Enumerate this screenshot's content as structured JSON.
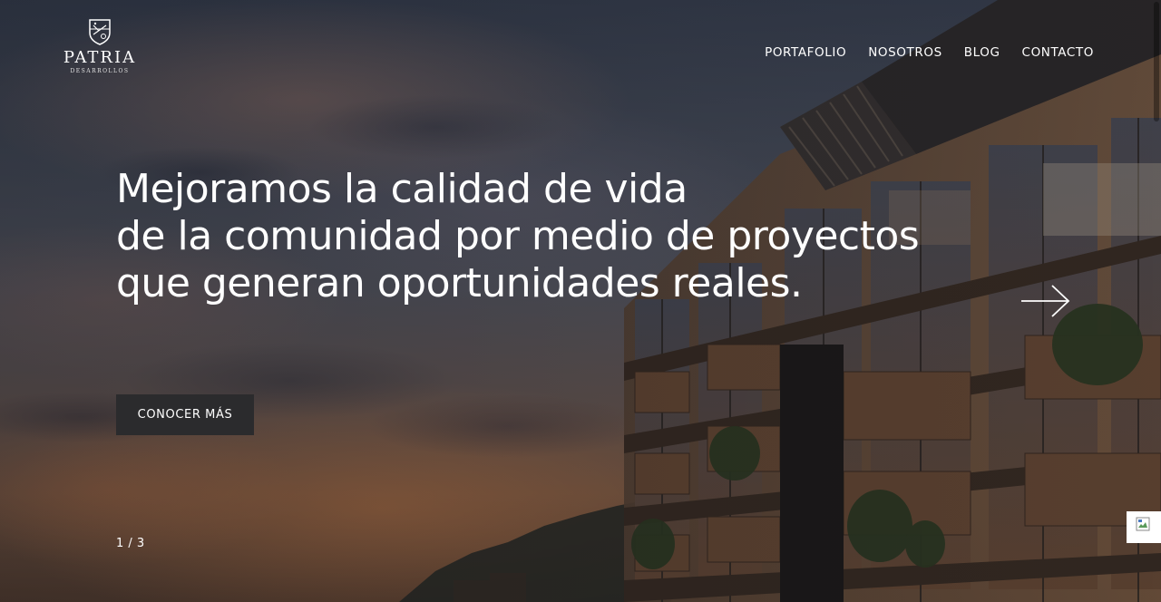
{
  "logo": {
    "name": "PATRIA",
    "subtitle": "DESARROLLOS",
    "icon": "crest-icon"
  },
  "nav": {
    "items": [
      {
        "label": "PORTAFOLIO"
      },
      {
        "label": "NOSOTROS"
      },
      {
        "label": "BLOG"
      },
      {
        "label": "CONTACTO"
      }
    ]
  },
  "hero": {
    "headline_lines": [
      "Mejoramos la calidad de vida",
      "de la comunidad por medio de proyectos",
      "que generan oportunidades reales."
    ],
    "cta_label": "CONOCER MÁS",
    "slide_counter": "1 / 3",
    "next_icon": "arrow-right-icon"
  },
  "widget": {
    "icon": "broken-image-icon"
  },
  "colors": {
    "text": "#ffffff",
    "button_bg": "#2b2b2d"
  }
}
